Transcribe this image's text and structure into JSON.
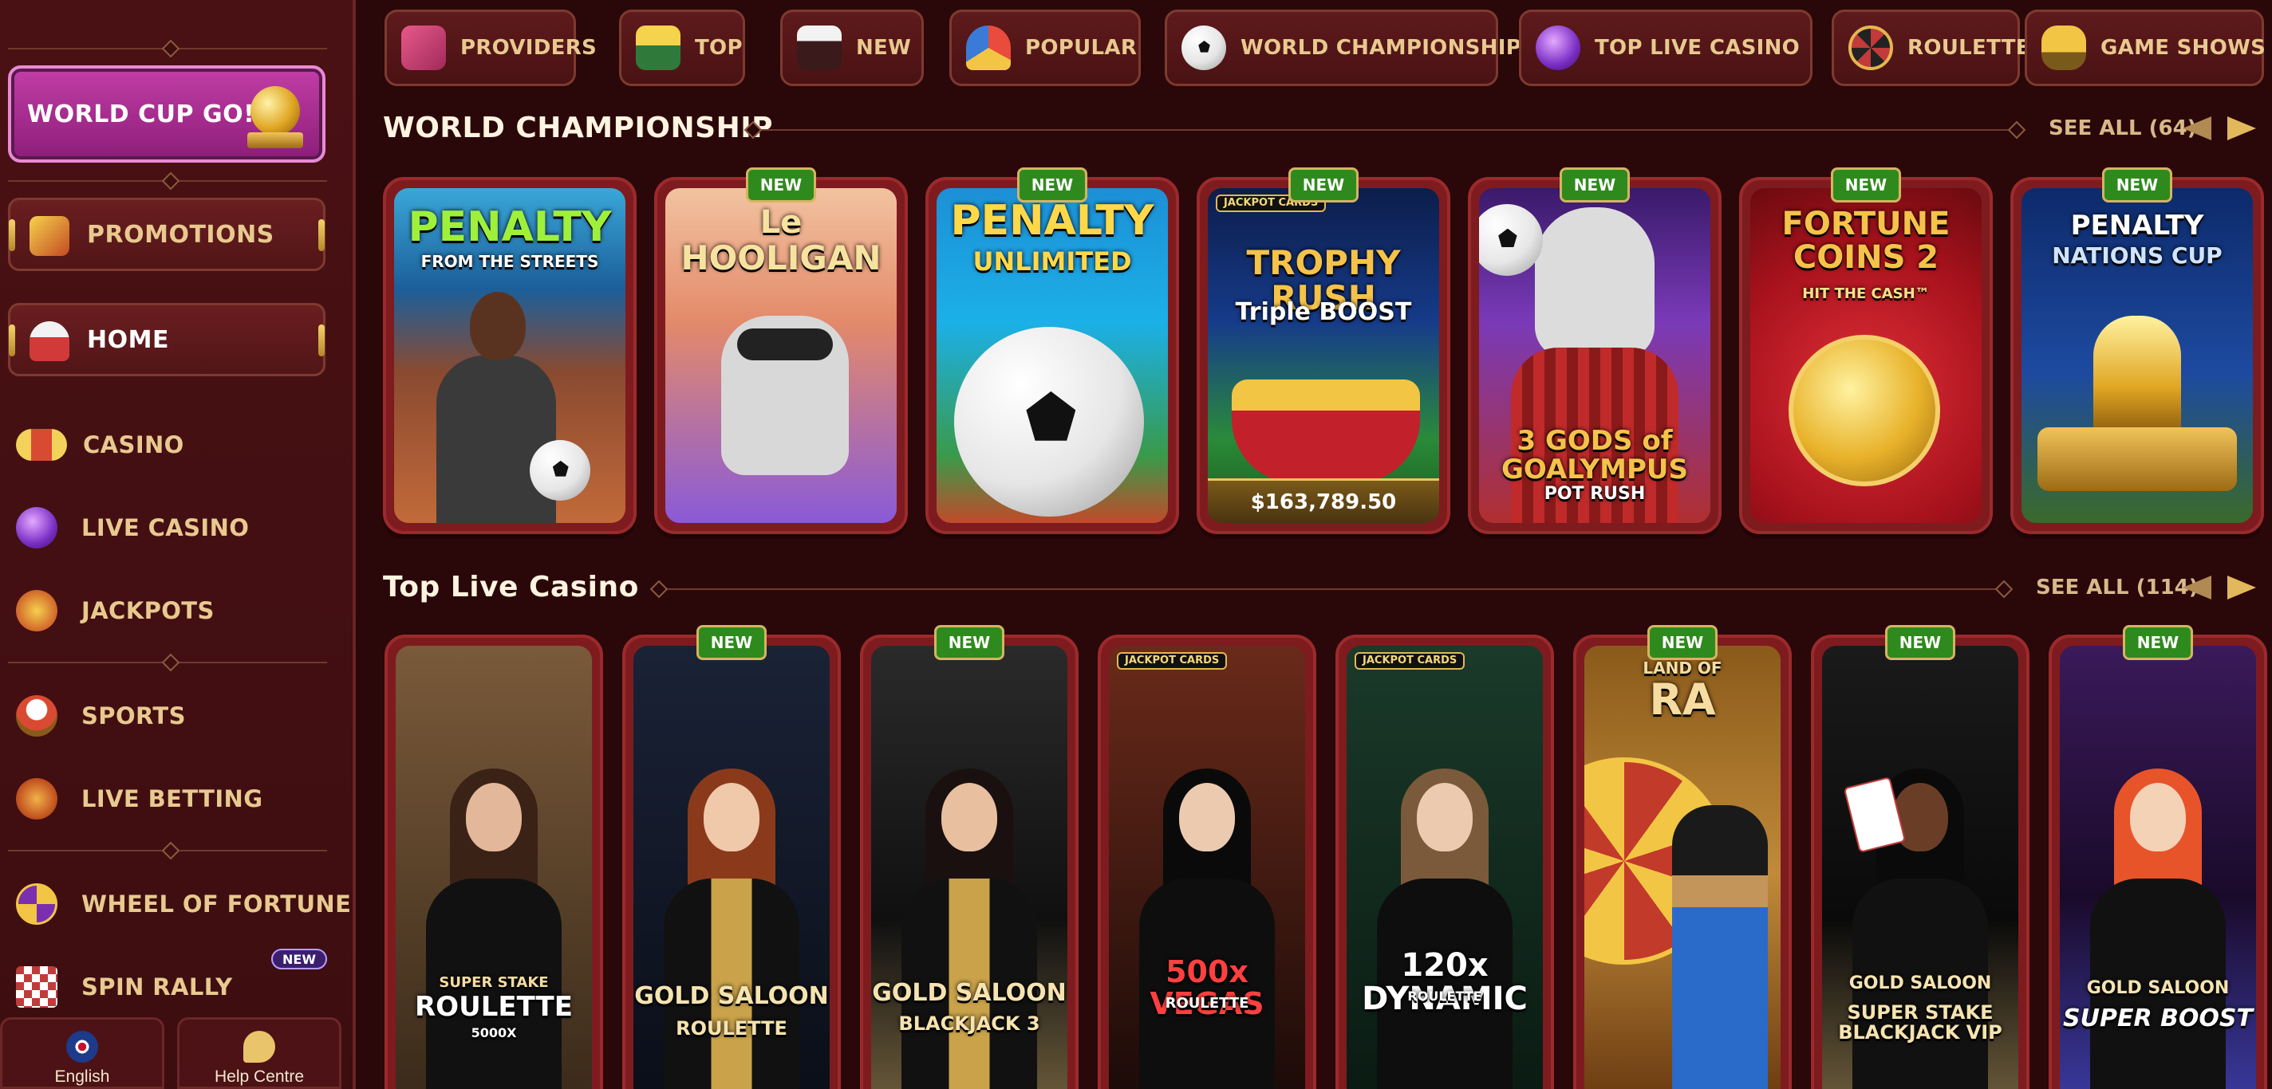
{
  "sidebar": {
    "promo_banner": "WORLD CUP GO!",
    "pills": [
      {
        "label": "PROMOTIONS",
        "icon": "jack-in-box-icon"
      },
      {
        "label": "HOME",
        "icon": "home-tent-icon"
      }
    ],
    "items": [
      {
        "label": "CASINO",
        "icon": "slot-reels-icon"
      },
      {
        "label": "LIVE CASINO",
        "icon": "crystal-ball-icon"
      },
      {
        "label": "JACKPOTS",
        "icon": "sevens-icon"
      },
      {
        "label": "SPORTS",
        "icon": "trophy-ball-icon"
      },
      {
        "label": "LIVE BETTING",
        "icon": "play-ball-icon"
      },
      {
        "label": "WHEEL OF FORTUNE",
        "icon": "wheel-icon"
      },
      {
        "label": "SPIN RALLY",
        "icon": "checkered-flag-icon"
      }
    ],
    "spin_rally_badge": "NEW",
    "language_label": "English",
    "help_label": "Help Centre"
  },
  "nav_tabs": [
    {
      "label": "PROVIDERS",
      "icon": "book-icon"
    },
    {
      "label": "TOP",
      "icon": "star-box-icon"
    },
    {
      "label": "NEW",
      "icon": "magic-hat-icon"
    },
    {
      "label": "POPULAR",
      "icon": "jester-hat-icon"
    },
    {
      "label": "WORLD CHAMPIONSHIP",
      "icon": "soccer-ball-icon"
    },
    {
      "label": "TOP LIVE CASINO",
      "icon": "crystal-ball-icon"
    },
    {
      "label": "ROULETTE",
      "icon": "roulette-icon"
    },
    {
      "label": "GAME SHOWS",
      "icon": "microphone-icon"
    }
  ],
  "sections": {
    "world_championship": {
      "title": "WORLD CHAMPIONSHIP",
      "see_all": "SEE ALL (64)"
    },
    "top_live_casino": {
      "title": "Top Live Casino",
      "see_all": "SEE ALL (114)"
    }
  },
  "badge_new": "NEW",
  "world_games": [
    {
      "title_line1": "PENALTY",
      "title_line2": "FROM THE STREETS",
      "new": false
    },
    {
      "title_line1": "Le",
      "title_line2": "HOOLIGAN",
      "new": true
    },
    {
      "title_line1": "PENALTY",
      "title_line2": "UNLIMITED",
      "new": true
    },
    {
      "title_line1": "TROPHY RUSH",
      "title_line2": "Triple BOOST",
      "jackpot_tag": "JACKPOT CARDS",
      "jackpot_amount": "$163,789.50",
      "new": true
    },
    {
      "title_line1": "3 GODS of GOALYMPUS",
      "title_line2": "POT RUSH",
      "new": true
    },
    {
      "title_line1": "FORTUNE COINS 2",
      "title_line2": "HIT THE CASH™",
      "new": true
    },
    {
      "title_line1": "PENALTY",
      "title_line2": "NATIONS CUP",
      "new": true
    }
  ],
  "live_games": [
    {
      "title_line1": "SUPER STAKE",
      "title_line2": "ROULETTE",
      "title_line3": "5000X",
      "new": false
    },
    {
      "title_line1": "GOLD SALOON",
      "title_line2": "ROULETTE",
      "new": true
    },
    {
      "title_line1": "GOLD SALOON",
      "title_line2": "BLACKJACK 3",
      "new": true
    },
    {
      "title_line1": "500x VEGAS",
      "title_line2": "ROULETTE",
      "jackpot_tag": "JACKPOT CARDS",
      "new": false
    },
    {
      "title_line1": "120x DYNAMIC",
      "title_line2": "ROULETTE",
      "jackpot_tag": "JACKPOT CARDS",
      "new": false
    },
    {
      "title_line1": "LAND OF",
      "title_line2": "RA",
      "new": true
    },
    {
      "title_line1": "GOLD SALOON",
      "title_line2": "SUPER STAKE BLACKJACK VIP",
      "new": true
    },
    {
      "title_line1": "GOLD SALOON",
      "title_line2": "SUPER BOOST",
      "new": true
    }
  ],
  "colors": {
    "accent_gold": "#e8c98f",
    "bg": "#2a0709",
    "badge_green": "#2f8a1d"
  }
}
